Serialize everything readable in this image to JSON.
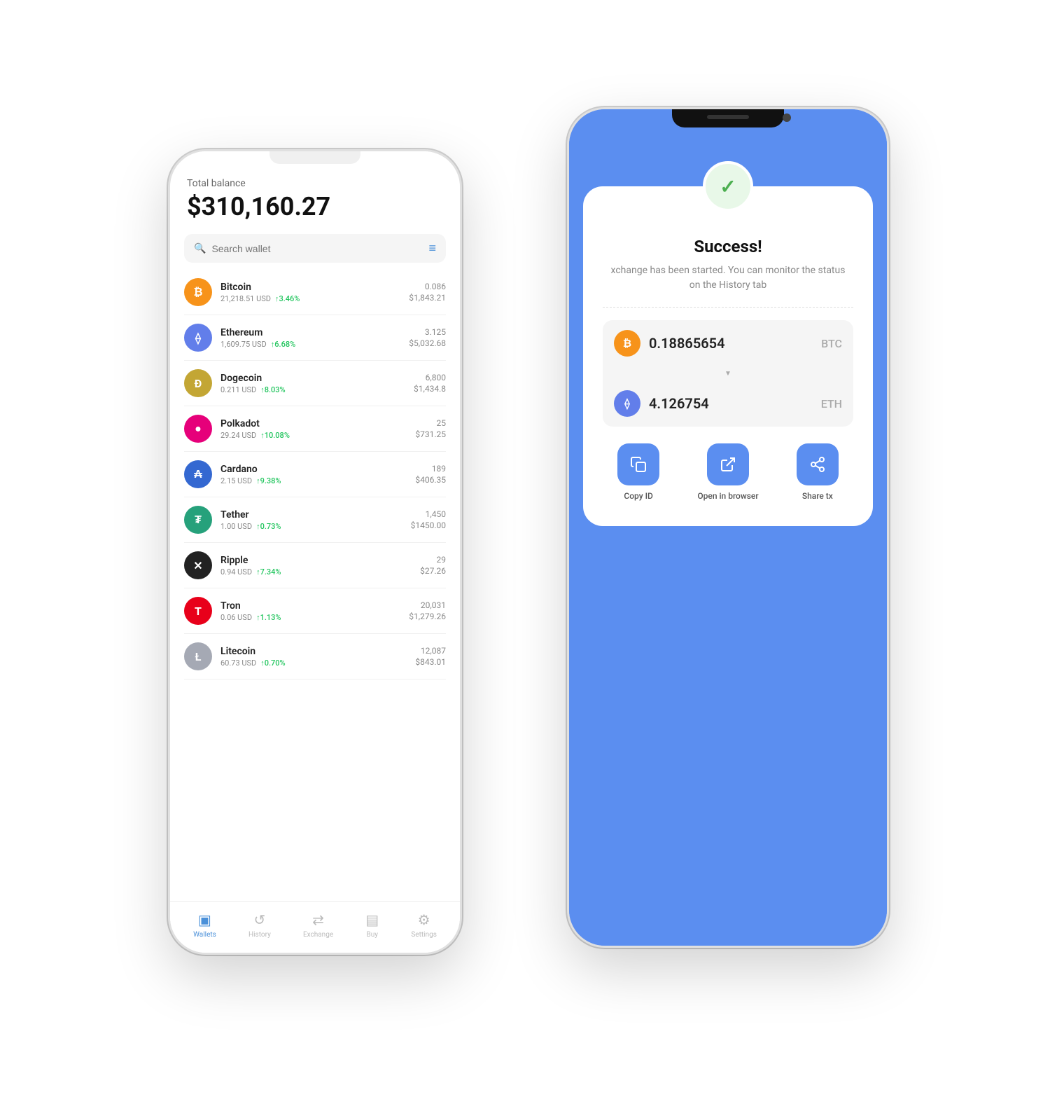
{
  "left_phone": {
    "total_label": "Total balance",
    "total_amount": "$310,160.27",
    "search_placeholder": "Search wallet",
    "coins": [
      {
        "id": "btc",
        "name": "Bitcoin",
        "usd": "21,218.51 USD",
        "change": "↑3.46%",
        "amount": "0.086",
        "value": "$1,843.21",
        "color": "btc-color",
        "symbol": "₿"
      },
      {
        "id": "eth",
        "name": "Ethereum",
        "usd": "1,609.75 USD",
        "change": "↑6.68%",
        "amount": "3.125",
        "value": "$5,032.68",
        "color": "eth-color",
        "symbol": "⟠"
      },
      {
        "id": "doge",
        "name": "Dogecoin",
        "usd": "0.211 USD",
        "change": "↑8.03%",
        "amount": "6,800",
        "value": "$1,434.8",
        "color": "doge-color",
        "symbol": "Ð"
      },
      {
        "id": "dot",
        "name": "Polkadot",
        "usd": "29.24 USD",
        "change": "↑10.08%",
        "amount": "25",
        "value": "$731.25",
        "color": "dot-color",
        "symbol": "●"
      },
      {
        "id": "ada",
        "name": "Cardano",
        "usd": "2.15 USD",
        "change": "↑9.38%",
        "amount": "189",
        "value": "$406.35",
        "color": "ada-color",
        "symbol": "₳"
      },
      {
        "id": "usdt",
        "name": "Tether",
        "usd": "1.00 USD",
        "change": "↑0.73%",
        "amount": "1,450",
        "value": "$1450.00",
        "color": "usdt-color",
        "symbol": "₮"
      },
      {
        "id": "xrp",
        "name": "Ripple",
        "usd": "0.94 USD",
        "change": "↑7.34%",
        "amount": "29",
        "value": "$27.26",
        "color": "xrp-color",
        "symbol": "✕"
      },
      {
        "id": "trx",
        "name": "Tron",
        "usd": "0.06 USD",
        "change": "↑1.13%",
        "amount": "20,031",
        "value": "$1,279.26",
        "color": "trx-color",
        "symbol": "T"
      },
      {
        "id": "ltc",
        "name": "Litecoin",
        "usd": "60.73 USD",
        "change": "↑0.70%",
        "amount": "12,087",
        "value": "$843.01",
        "color": "ltc-color",
        "symbol": "Ł"
      }
    ],
    "nav": [
      {
        "id": "wallets",
        "label": "Wallets",
        "active": true,
        "icon": "▣"
      },
      {
        "id": "history",
        "label": "History",
        "active": false,
        "icon": "↺"
      },
      {
        "id": "exchange",
        "label": "Exchange",
        "active": false,
        "icon": "⇄"
      },
      {
        "id": "buy",
        "label": "Buy",
        "active": false,
        "icon": "▤"
      },
      {
        "id": "settings",
        "label": "Settings",
        "active": false,
        "icon": "⚙"
      }
    ]
  },
  "right_phone": {
    "background_color": "#5b8ef0",
    "success_title": "Success!",
    "success_message": "xchange has been started. You can monitor the status on the History tab",
    "from_amount": "0.18865654",
    "from_ticker": "BTC",
    "to_amount": "4.126754",
    "to_ticker": "ETH",
    "actions": [
      {
        "id": "copy-id",
        "label": "Copy ID",
        "icon": "⧉"
      },
      {
        "id": "open-browser",
        "label": "Open in browser",
        "icon": "↗"
      },
      {
        "id": "share-tx",
        "label": "Share tx",
        "icon": "↗"
      }
    ]
  }
}
